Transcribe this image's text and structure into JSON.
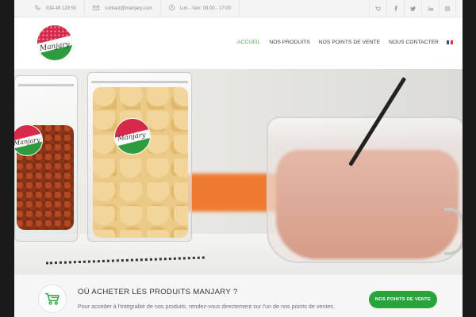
{
  "topbar": {
    "phone": "034 48 129 50",
    "email": "contact@manjary.com",
    "hours": "Lun - Ven: 08:00 - 17:00",
    "social": [
      "cart-icon",
      "facebook-icon",
      "twitter-icon",
      "linkedin-icon",
      "instagram-icon"
    ]
  },
  "brand": {
    "logo_text": "Manjary"
  },
  "nav": {
    "items": [
      {
        "label": "ACCUEIL",
        "active": true
      },
      {
        "label": "NOS PRODUITS",
        "active": false
      },
      {
        "label": "NOS POINTS DE VENTE",
        "active": false
      },
      {
        "label": "NOUS CONTACTER",
        "active": false
      }
    ],
    "language": "flag-fr-icon"
  },
  "hero": {
    "sticker_text": "Manjary"
  },
  "cta_band": {
    "title": "OÙ ACHETER LES PRODUITS MANJARY ?",
    "text": "Pour accéder à l'intégralité de nos produits, rendez-vous directement sur l'un de nos points de ventes.",
    "button_label": "NOS POINTS DE VENTE"
  },
  "colors": {
    "accent": "#27a43a",
    "nav_active": "#4caf50",
    "logo_red": "#d7294a",
    "logo_green": "#2e9b3e"
  }
}
